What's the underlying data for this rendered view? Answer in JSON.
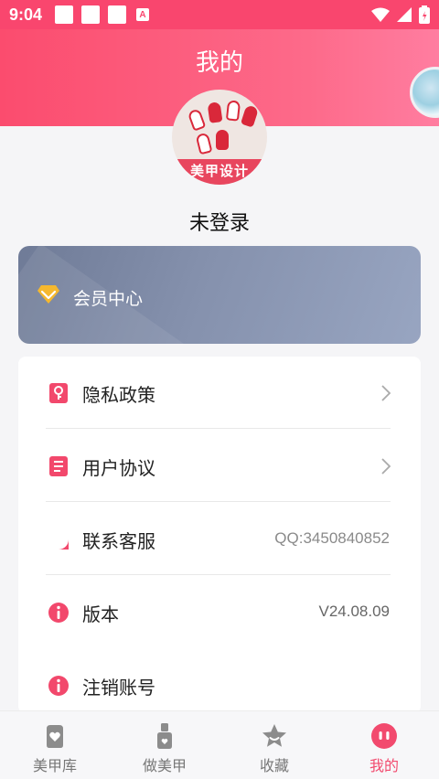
{
  "status_bar": {
    "time": "9:04",
    "a_icon": "A"
  },
  "header": {
    "title": "我的"
  },
  "avatar": {
    "caption": "美甲设计"
  },
  "user": {
    "name": "未登录"
  },
  "vip": {
    "label": "会员中心"
  },
  "menu": {
    "items": [
      {
        "icon": "privacy-key-icon",
        "label": "隐私政策",
        "value": ""
      },
      {
        "icon": "agreement-doc-icon",
        "label": "用户协议",
        "value": ""
      },
      {
        "icon": "customer-service-icon",
        "label": "联系客服",
        "value": "QQ:3450840852"
      },
      {
        "icon": "info-icon",
        "label": "版本",
        "value": "V24.08.09"
      },
      {
        "icon": "info-icon",
        "label": "注销账号",
        "value": ""
      }
    ]
  },
  "tabbar": {
    "tabs": [
      {
        "label": "美甲库"
      },
      {
        "label": "做美甲"
      },
      {
        "label": "收藏"
      },
      {
        "label": "我的"
      }
    ],
    "active_index": 3
  },
  "colors": {
    "accent": "#f24a6e",
    "vip_gradient_start": "#6f7b97",
    "vip_gradient_end": "#98a5c1",
    "diamond": "#f5b82e"
  }
}
